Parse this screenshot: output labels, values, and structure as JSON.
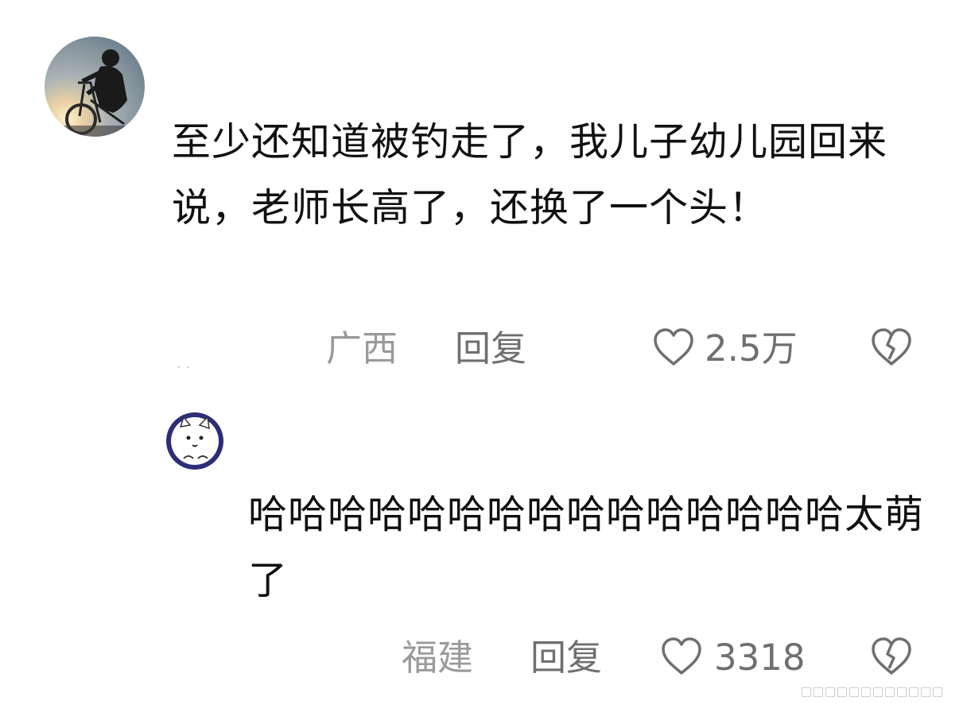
{
  "comments": [
    {
      "text": "至少还知道被钓走了，我儿子幼儿园回来说，老师长高了，还换了一个头！",
      "location": "广西",
      "reply_label": "回复",
      "like_count": "2.5万"
    },
    {
      "text": "哈哈哈哈哈哈哈哈哈哈哈哈哈哈哈太萌了",
      "location": "福建",
      "reply_label": "回复",
      "like_count": "3318"
    }
  ],
  "icons": {
    "like": "heart-outline-icon",
    "dislike": "broken-heart-icon"
  },
  "colors": {
    "text": "#111111",
    "meta_light": "#9a9a9a",
    "meta_dark": "#6f6f6f"
  }
}
